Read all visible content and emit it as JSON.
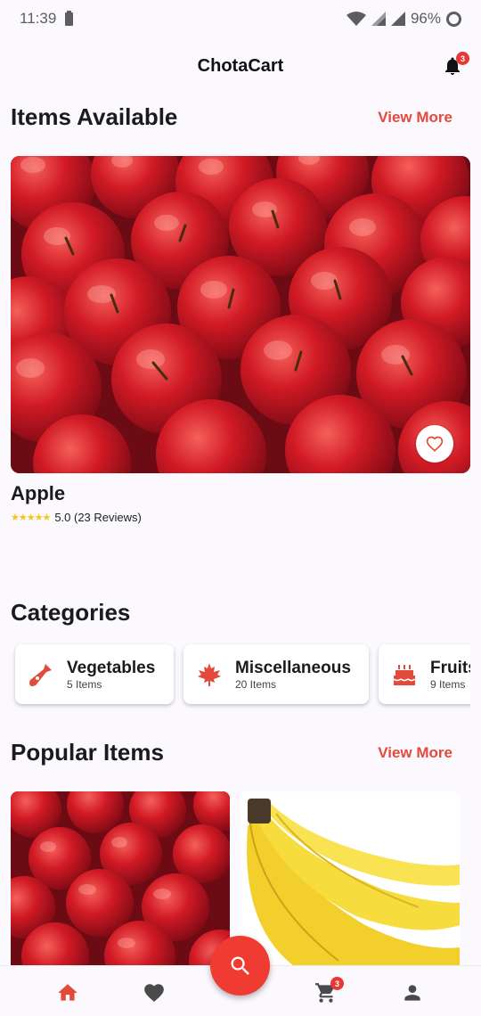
{
  "status_bar": {
    "time": "11:39",
    "battery_percent": "96%"
  },
  "app_bar": {
    "title": "ChotaCart",
    "notification_count": "3"
  },
  "items_available": {
    "title": "Items Available",
    "view_more": "View More",
    "featured": {
      "name": "Apple",
      "rating": "5.0 (23 Reviews)",
      "stars": "★★★★★"
    }
  },
  "categories": {
    "title": "Categories",
    "items": [
      {
        "name": "Vegetables",
        "count": "5 Items",
        "icon": "carrot-icon"
      },
      {
        "name": "Miscellaneous",
        "count": "20 Items",
        "icon": "maple-leaf-icon"
      },
      {
        "name": "Fruits",
        "count": "9 Items",
        "icon": "cake-icon"
      }
    ]
  },
  "popular_items": {
    "title": "Popular Items",
    "view_more": "View More"
  },
  "bottom_nav": {
    "items": [
      "home-icon",
      "heart-icon",
      "search-icon",
      "cart-icon",
      "person-icon"
    ],
    "cart_count": "3"
  },
  "colors": {
    "accent": "#e24a3b",
    "fab": "#ef3b32",
    "star": "#f5c518"
  }
}
